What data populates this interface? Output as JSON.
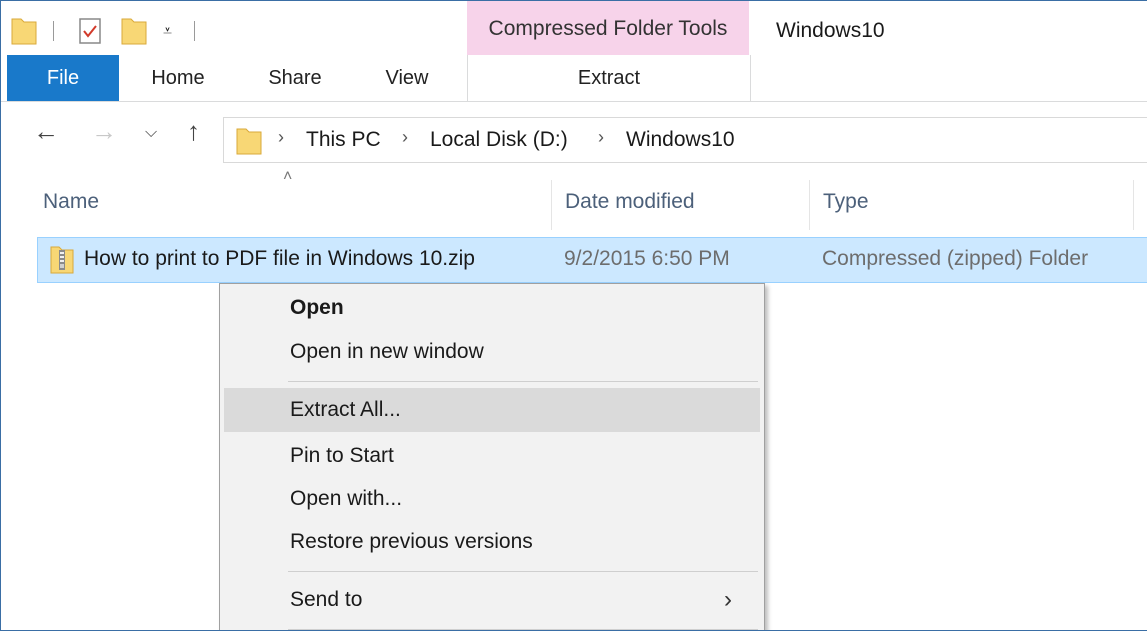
{
  "window": {
    "title": "Windows10",
    "context_tab_header": "Compressed Folder Tools"
  },
  "ribbon": {
    "tabs": {
      "file": "File",
      "home": "Home",
      "share": "Share",
      "view": "View",
      "extract": "Extract"
    }
  },
  "address": {
    "crumbs": [
      "This PC",
      "Local Disk (D:)",
      "Windows10"
    ]
  },
  "columns": {
    "name": "Name",
    "date": "Date modified",
    "type": "Type"
  },
  "file": {
    "name": "How to print to PDF file in Windows 10.zip",
    "date": "9/2/2015 6:50 PM",
    "type": "Compressed (zipped) Folder"
  },
  "menu": {
    "open": "Open",
    "open_new_window": "Open in new window",
    "extract_all": "Extract All...",
    "pin_to_start": "Pin to Start",
    "open_with": "Open with...",
    "restore_previous": "Restore previous versions",
    "send_to": "Send to"
  },
  "colors": {
    "accent": "#1979ca",
    "context_tab": "#f7d3ea",
    "selection": "#cce8ff",
    "menu_highlight": "#dadada"
  }
}
